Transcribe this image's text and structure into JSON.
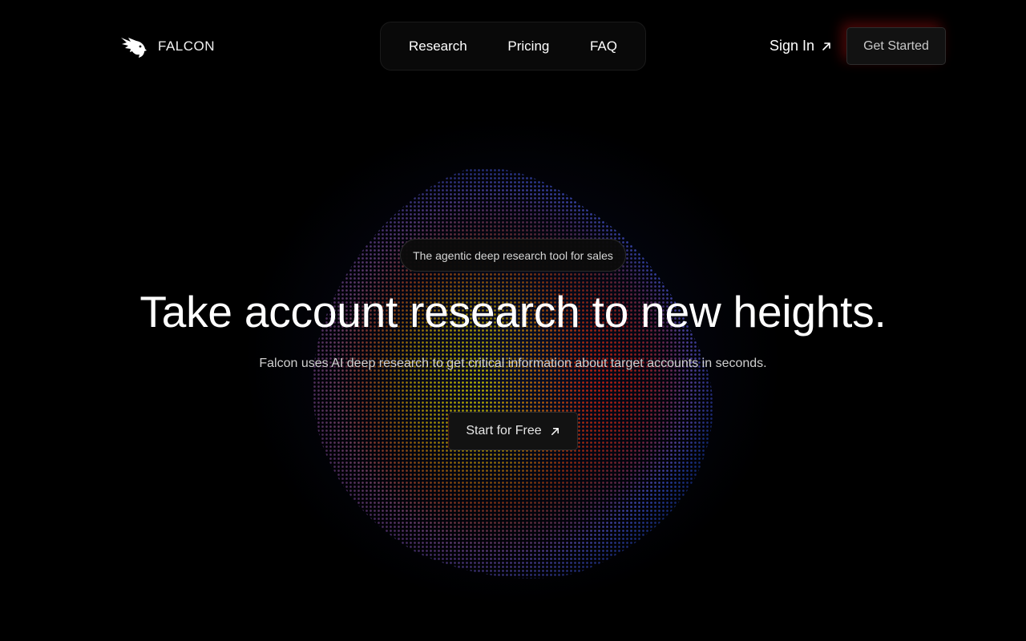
{
  "brand": {
    "name": "FALCON",
    "logo_icon": "falcon-head-icon"
  },
  "nav": {
    "links": [
      {
        "label": "Research"
      },
      {
        "label": "Pricing"
      },
      {
        "label": "FAQ"
      }
    ],
    "sign_in_label": "Sign In",
    "sign_in_icon": "arrow-up-right-icon",
    "get_started_label": "Get Started"
  },
  "hero": {
    "badge": "The agentic deep research tool for sales",
    "headline": "Take account research to new heights.",
    "subtext": "Falcon uses AI deep research to get critical information about target accounts in seconds.",
    "cta_label": "Start for Free",
    "cta_icon": "arrow-up-right-icon"
  },
  "colors": {
    "background": "#000000",
    "accent_red": "#d21414",
    "orb_blue": "#2a4fd8",
    "orb_yellow": "#c8b400"
  }
}
